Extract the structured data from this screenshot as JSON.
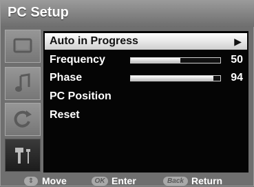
{
  "title": "PC Setup",
  "menu": {
    "items": [
      {
        "label": "Auto in Progress",
        "highlighted": true,
        "arrow": "▶"
      },
      {
        "label": "Frequency",
        "value": "50",
        "level": 0.55
      },
      {
        "label": "Phase",
        "value": "94",
        "level": 0.92
      },
      {
        "label": "PC Position"
      },
      {
        "label": "Reset"
      }
    ]
  },
  "sidebar": {
    "icons": [
      "screen-icon",
      "music-note-icon",
      "refresh-icon",
      "tools-icon"
    ]
  },
  "footer": {
    "move": {
      "badge": "⇕",
      "label": "Move"
    },
    "enter": {
      "badge": "OK",
      "label": "Enter"
    },
    "return": {
      "badge": "Back",
      "label": "Return"
    }
  },
  "colors": {
    "panel": "#6f6f6f",
    "content": "#050505",
    "highlight": "#ffffff"
  }
}
